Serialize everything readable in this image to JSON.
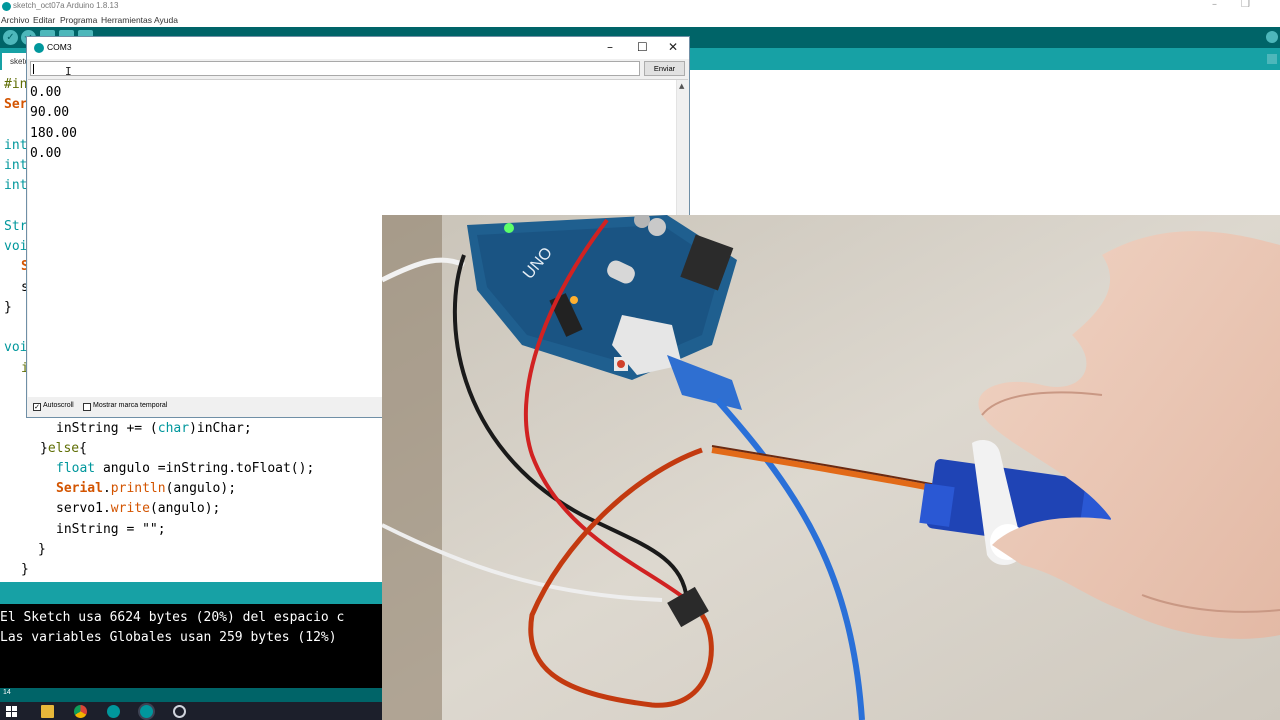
{
  "ide": {
    "title": "sketch_oct07a Arduino 1.8.13",
    "menu": [
      "Archivo",
      "Editar",
      "Programa",
      "Herramientas",
      "Ayuda"
    ],
    "tab_label": "sketch_oct07a",
    "code_fragments": [
      "#in",
      "Ser",
      "int",
      "int",
      "int",
      "Str",
      "voi",
      "S",
      "s",
      "}",
      "voi",
      "i"
    ],
    "code_lines": {
      "l1_var": "inString",
      "l1_op": " += (",
      "l1_type": "char",
      "l1_rest": ")inChar;",
      "l2_close": "}",
      "l2_kw": "else",
      "l2_brace": "{",
      "l3_type": "float",
      "l3_rest": " angulo =inString.toFloat();",
      "l4_obj": "Serial",
      "l4_dot": ".",
      "l4_fn": "println",
      "l4_rest": "(angulo);",
      "l5_pre": "servo1.",
      "l5_fn": "write",
      "l5_rest": "(angulo);",
      "l6": "inString = \"\";",
      "l7": "}",
      "l8": "}"
    },
    "console_lines": [
      "El Sketch usa 6624 bytes (20%) del espacio c",
      "Las variables Globales usan 259 bytes (12%)"
    ],
    "footer_line_number": "14"
  },
  "serial_monitor": {
    "title": "COM3",
    "input_value": "",
    "send_label": "Enviar",
    "output": [
      "0.00",
      "90.00",
      "180.00",
      "0.00"
    ],
    "autoscroll_label": "Autoscroll",
    "autoscroll_checked": true,
    "timestamp_label": "Mostrar marca temporal",
    "timestamp_checked": false
  },
  "camera_overlay": {
    "board_label": "UNO"
  },
  "colors": {
    "toolbar": "#006468",
    "tabbar": "#17a1a5",
    "console_bg": "#000000",
    "keyword_type": "#00979c",
    "keyword_literal": "#d35400",
    "keyword_struct": "#5e6d03"
  }
}
